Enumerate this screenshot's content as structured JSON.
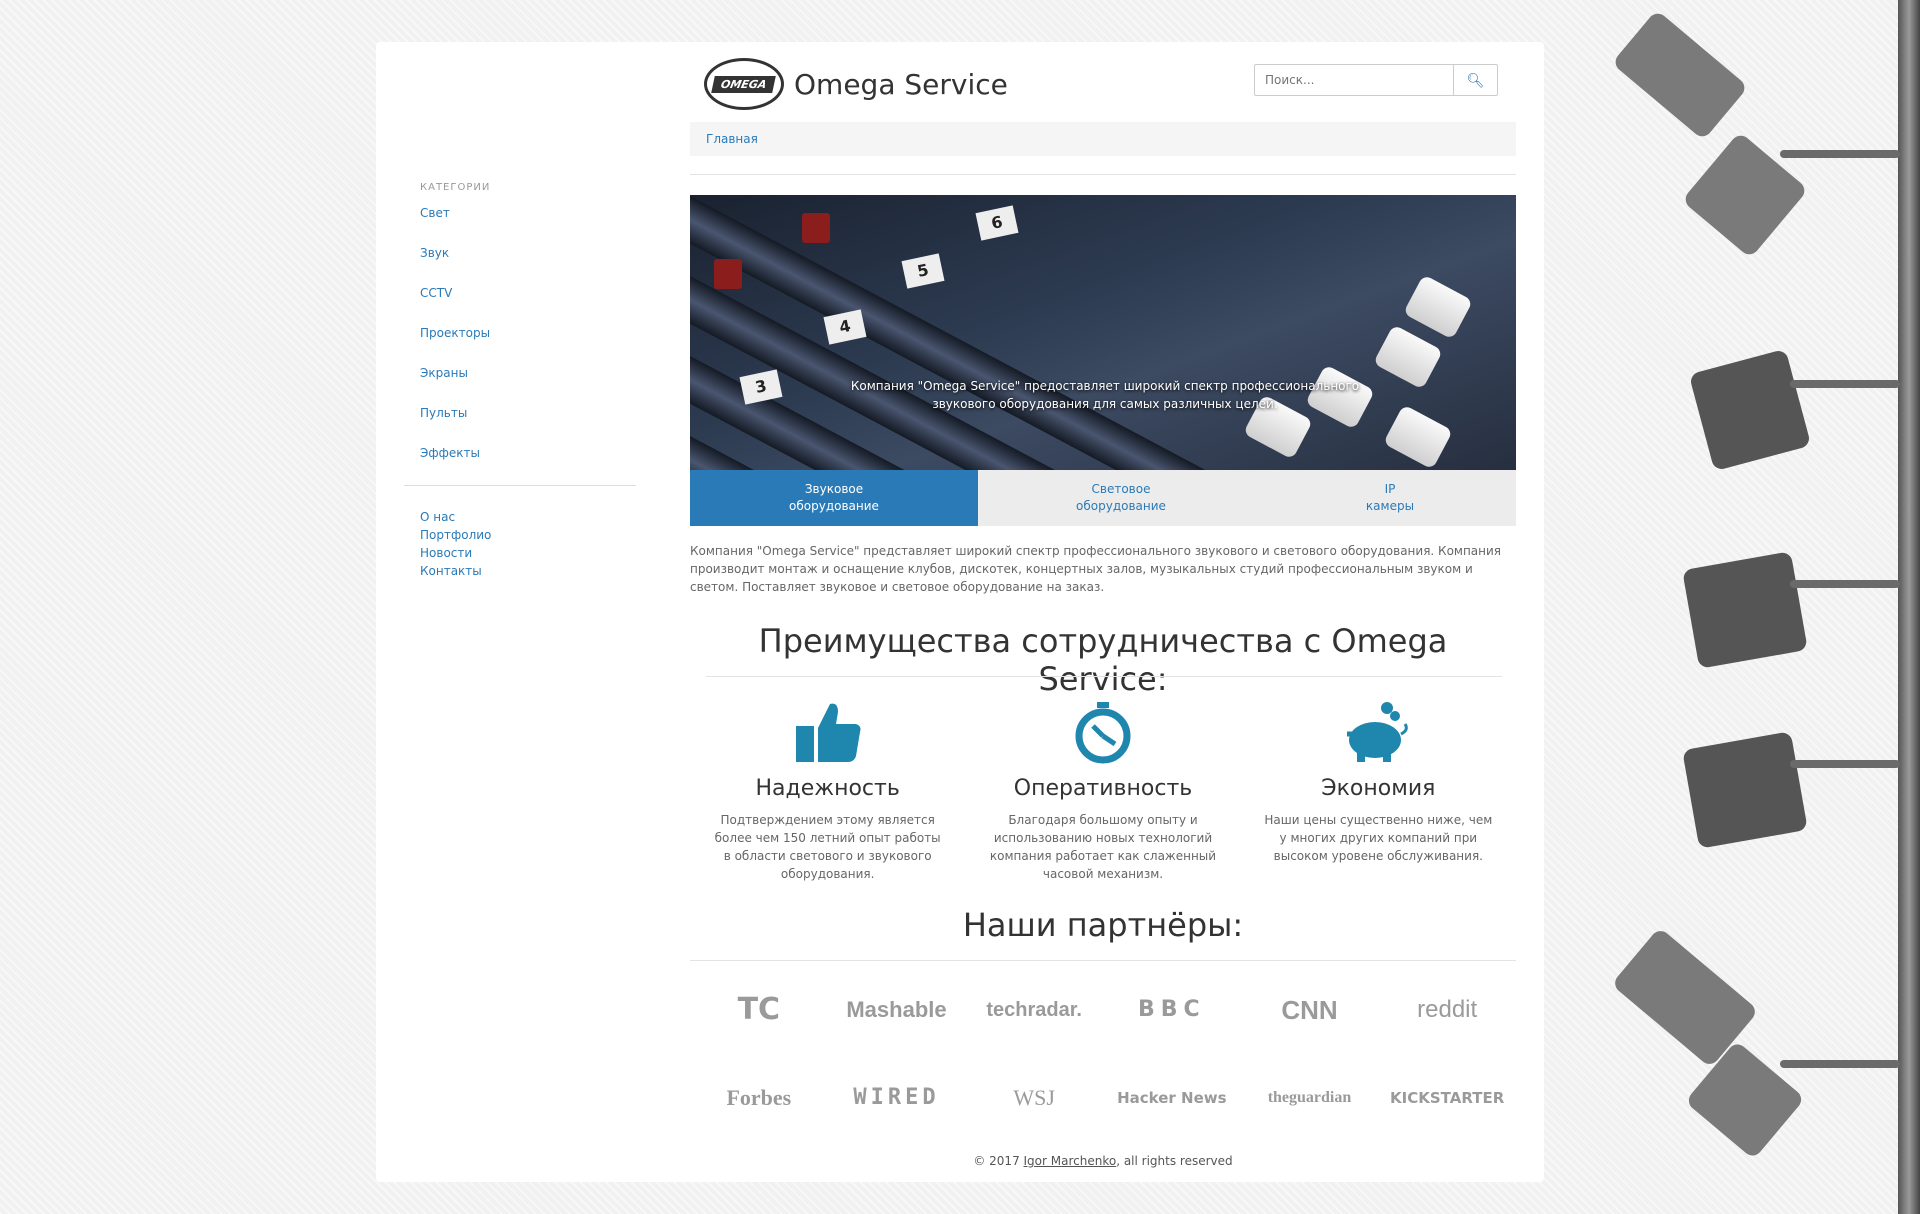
{
  "site": {
    "title": "Omega Service",
    "logo_text": "OMEGA"
  },
  "search": {
    "placeholder": "Поиск..."
  },
  "breadcrumb": {
    "home": "Главная"
  },
  "sidebar": {
    "categories_title": "КАТЕГОРИИ",
    "categories": [
      "Свет",
      "Звук",
      "CCTV",
      "Проекторы",
      "Экраны",
      "Пульты",
      "Эффекты"
    ],
    "info_links": [
      "О нас",
      "Портфолио",
      "Новости",
      "Контакты"
    ]
  },
  "hero": {
    "caption": "Компания \"Omega Service\" предоставляет широкий спектр профессионального звукового оборудования для самых различных целей.",
    "numbers": [
      "3",
      "4",
      "5",
      "6"
    ]
  },
  "tabs": [
    {
      "line1": "Звуковое",
      "line2": "оборудование",
      "active": true
    },
    {
      "line1": "Световое",
      "line2": "оборудование",
      "active": false
    },
    {
      "line1": "IP",
      "line2": "камеры",
      "active": false
    }
  ],
  "intro": "Компания \"Omega Service\" представляет широкий спектр профессионального звукового и светового оборудования. Компания производит монтаж и оснащение клубов, дискотек, концертных залов, музыкальных студий профессиональным звуком и светом. Поставляет звуковое и световое оборудование на заказ.",
  "advantages": {
    "title": "Преимущества сотрудничества с Omega Service:",
    "items": [
      {
        "icon": "thumbs-up-icon",
        "title": "Надежность",
        "text": "Подтверждением этому является более чем 150 летний опыт работы в области светового и звукового оборудования."
      },
      {
        "icon": "stopwatch-icon",
        "title": "Оперативность",
        "text": "Благодаря большому опыту и использованию новых технологий компания работает как слаженный часовой механизм."
      },
      {
        "icon": "piggy-bank-icon",
        "title": "Экономия",
        "text": "Наши цены существенно ниже, чем у многих других компаний при высоком уровене обслуживания."
      }
    ]
  },
  "partners": {
    "title": "Наши партнёры:",
    "items": [
      "TC",
      "Mashable",
      "techradar.",
      "BBC",
      "CNN",
      "reddit",
      "Forbes",
      "WIRED",
      "WSJ",
      "Hacker News",
      "theguardian",
      "KICKSTARTER"
    ]
  },
  "footer": {
    "prefix": "© 2017 ",
    "author": "Igor Marchenko",
    "suffix": ", all rights reserved"
  },
  "colors": {
    "accent": "#2a7ab8",
    "icon": "#1f86ad"
  }
}
